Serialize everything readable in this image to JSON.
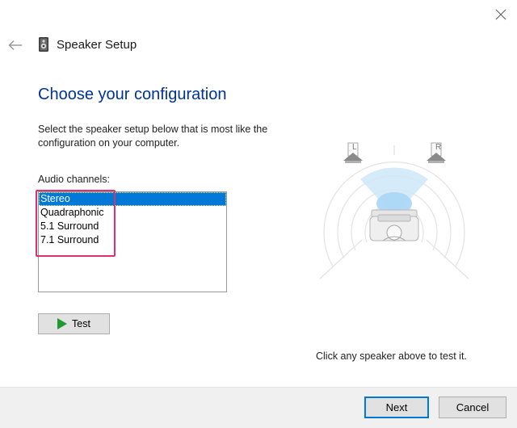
{
  "window": {
    "title": "Speaker Setup"
  },
  "page": {
    "heading": "Choose your configuration",
    "instructions": "Select the speaker setup below that is most like the configuration on your computer.",
    "list_label": "Audio channels:",
    "selected_channel": "Stereo",
    "channels": [
      "Stereo",
      "Quadraphonic",
      "5.1 Surround",
      "7.1 Surround"
    ],
    "test_label": "Test",
    "speaker_left_label": "L",
    "speaker_right_label": "R",
    "hint": "Click any speaker above to test it."
  },
  "footer": {
    "next_label": "Next",
    "cancel_label": "Cancel"
  },
  "colors": {
    "heading": "#003399",
    "selection": "#0078d7",
    "annotation_highlight": "#e0316d",
    "play_icon": "#1f9a2e"
  },
  "icons": {
    "back": "back-arrow-icon",
    "close": "close-icon",
    "app": "speaker-icon",
    "test": "play-icon"
  }
}
